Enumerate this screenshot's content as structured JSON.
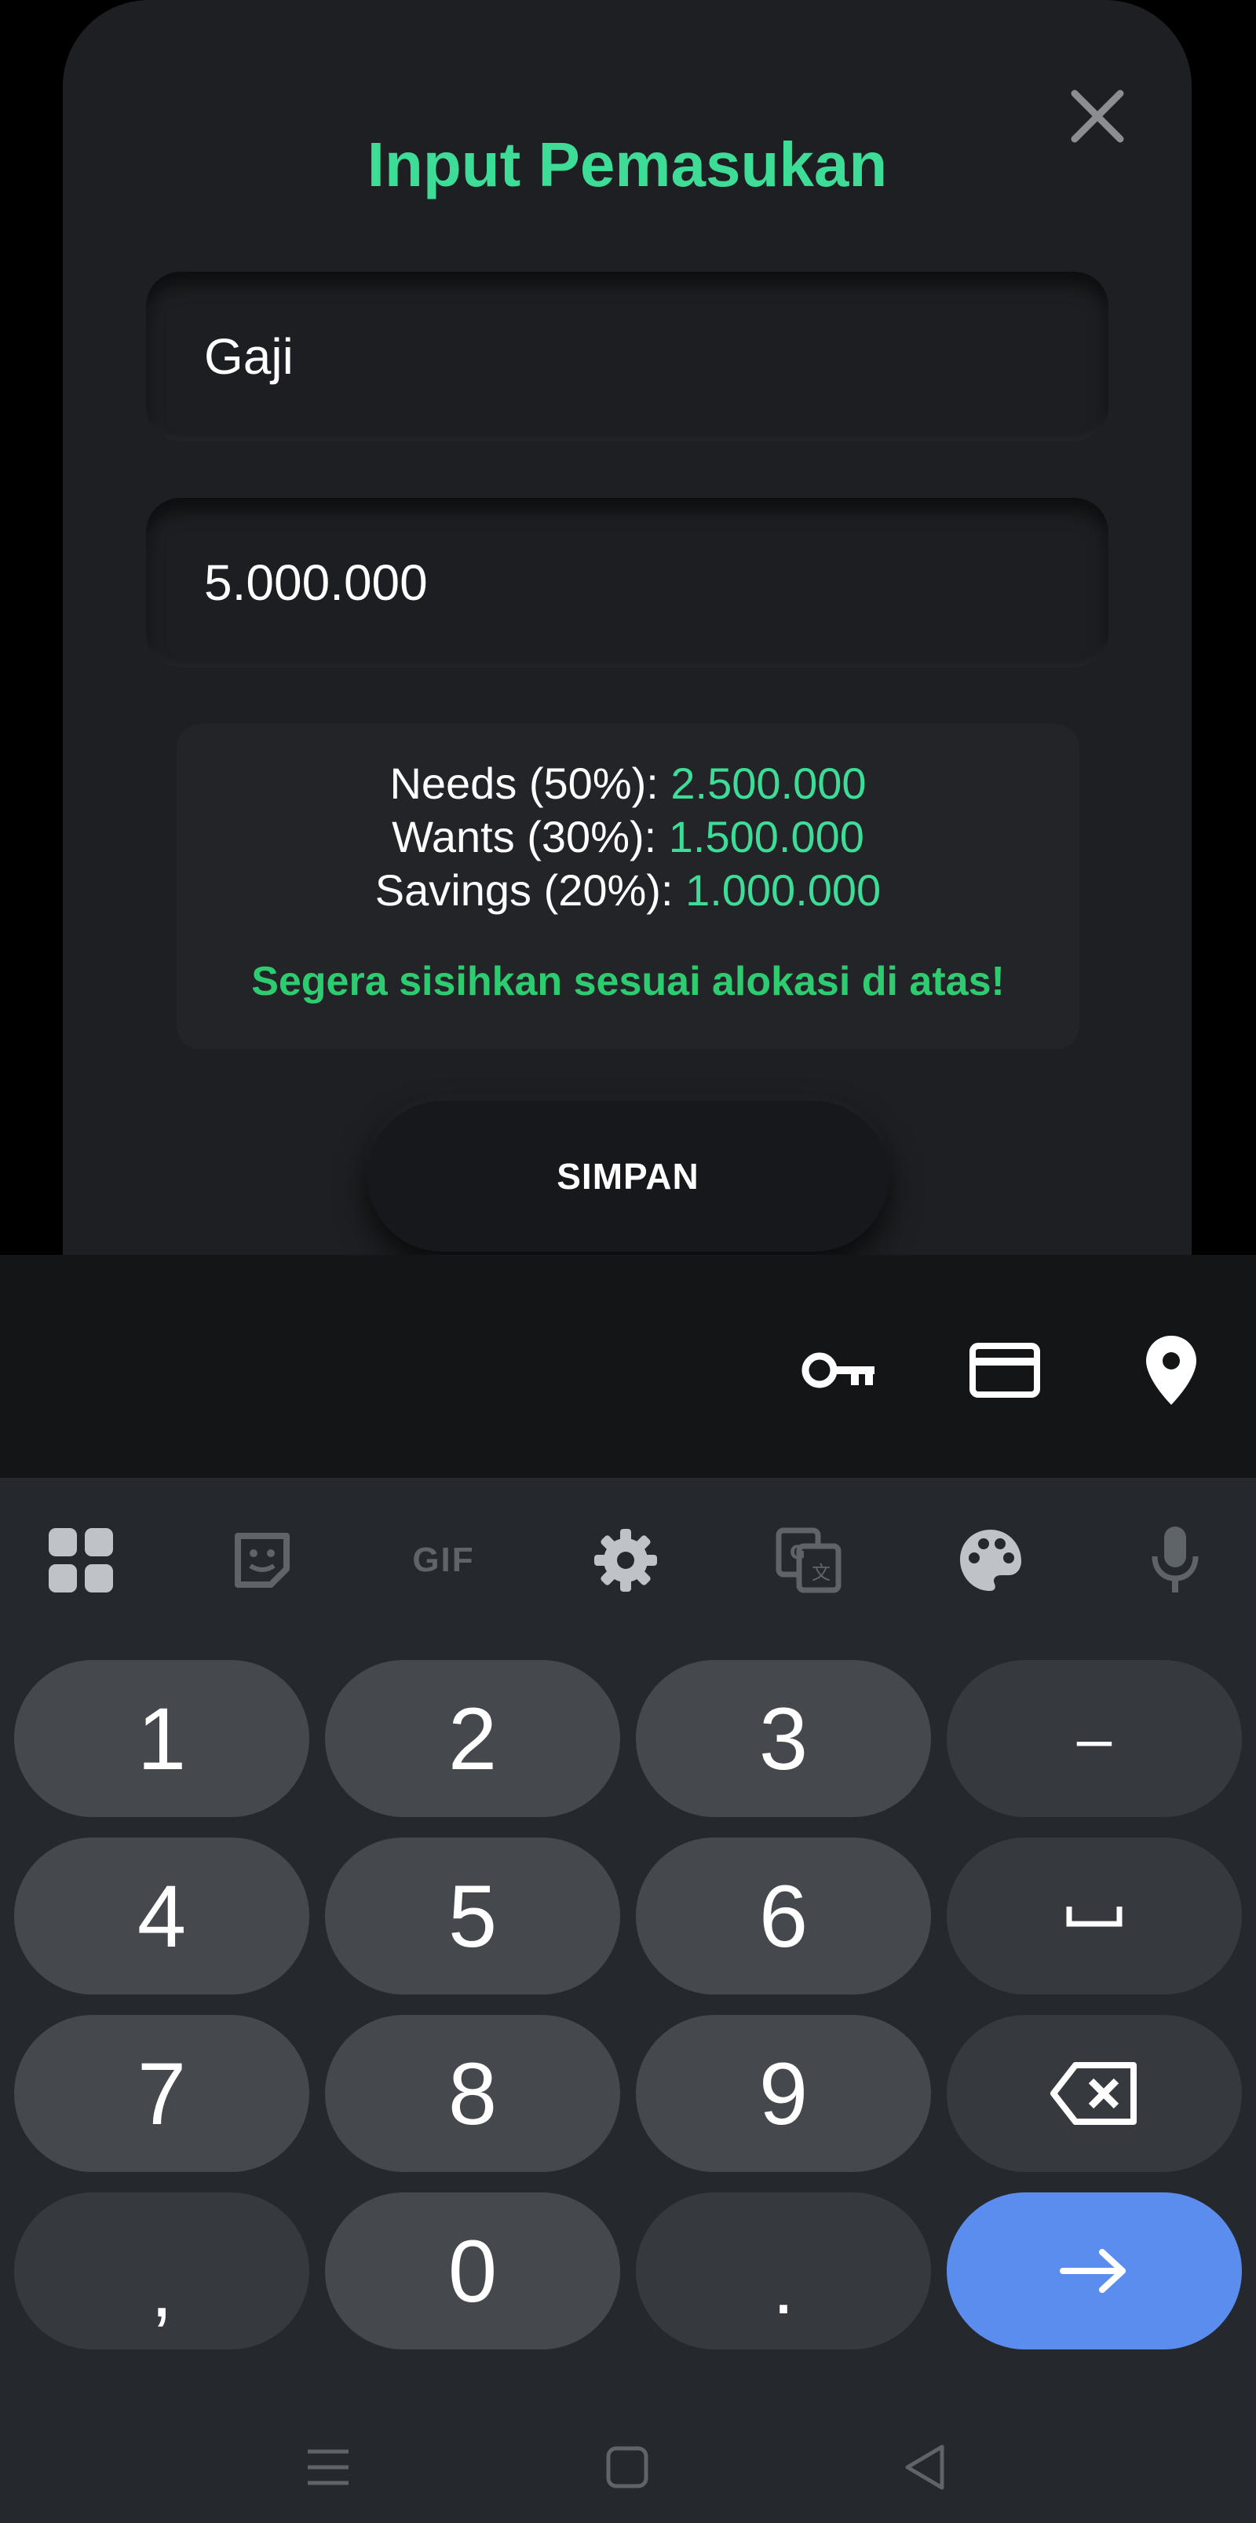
{
  "modal": {
    "title": "Input Pemasukan",
    "name_value": "Gaji",
    "amount_value": "5.000.000",
    "allocation": {
      "needs_label": "Needs (50%): ",
      "needs_value": "2.500.000",
      "wants_label": "Wants (30%): ",
      "wants_value": "1.500.000",
      "savings_label": "Savings (20%): ",
      "savings_value": "1.000.000",
      "note": "Segera sisihkan sesuai alokasi di atas!"
    },
    "save_label": "SIMPAN",
    "close_icon": "close-icon"
  },
  "autofill": {
    "icons": [
      "key-icon",
      "credit-card-icon",
      "location-pin-icon"
    ]
  },
  "keyboard": {
    "toolbar": {
      "icons": [
        "apps-grid-icon",
        "sticker-icon",
        "gif-icon",
        "settings-gear-icon",
        "translate-icon",
        "palette-icon",
        "microphone-icon"
      ],
      "gif_label": "GIF"
    },
    "keys": {
      "k1": "1",
      "k2": "2",
      "k3": "3",
      "minus": "–",
      "k4": "4",
      "k5": "5",
      "k6": "6",
      "space": "␣",
      "k7": "7",
      "k8": "8",
      "k9": "9",
      "backspace": "backspace-icon",
      "comma": ",",
      "k0": "0",
      "period": ".",
      "enter": "arrow-right-icon"
    }
  },
  "nav": {
    "icons": [
      "recents-menu-icon",
      "home-square-icon",
      "back-triangle-icon"
    ]
  },
  "colors": {
    "accent": "#3ddc97",
    "note_green": "#2ecc71",
    "modal_bg": "#1d1f22",
    "keyboard_bg": "#25282c",
    "key_bg": "#45484c",
    "enter_key": "#5b8def"
  }
}
